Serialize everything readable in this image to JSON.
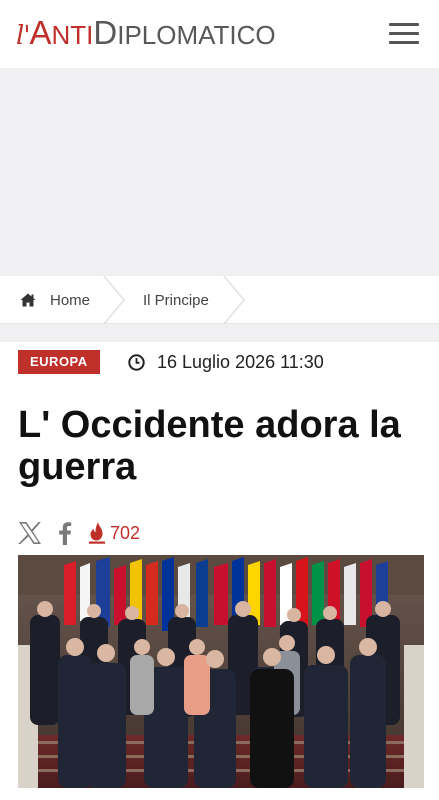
{
  "header": {
    "logo_prefix": "l'",
    "logo_anti_initial": "A",
    "logo_anti_rest": "NTI",
    "logo_diplo_initial": "D",
    "logo_diplo_rest": "IPLOMATICO"
  },
  "breadcrumb": {
    "home_label": "Home",
    "section_label": "Il Principe"
  },
  "article": {
    "category": "EUROPA",
    "date": "16 Luglio 2026 11:30",
    "title": "L' Occidente adora la guerra",
    "views": "702"
  },
  "colors": {
    "brand_red": "#c0302b",
    "logo_grey": "#58585a"
  },
  "icons": {
    "menu": "hamburger-icon",
    "home": "home-icon",
    "clock": "clock-icon",
    "x": "x-icon",
    "facebook": "facebook-icon",
    "views": "flame-icon"
  }
}
